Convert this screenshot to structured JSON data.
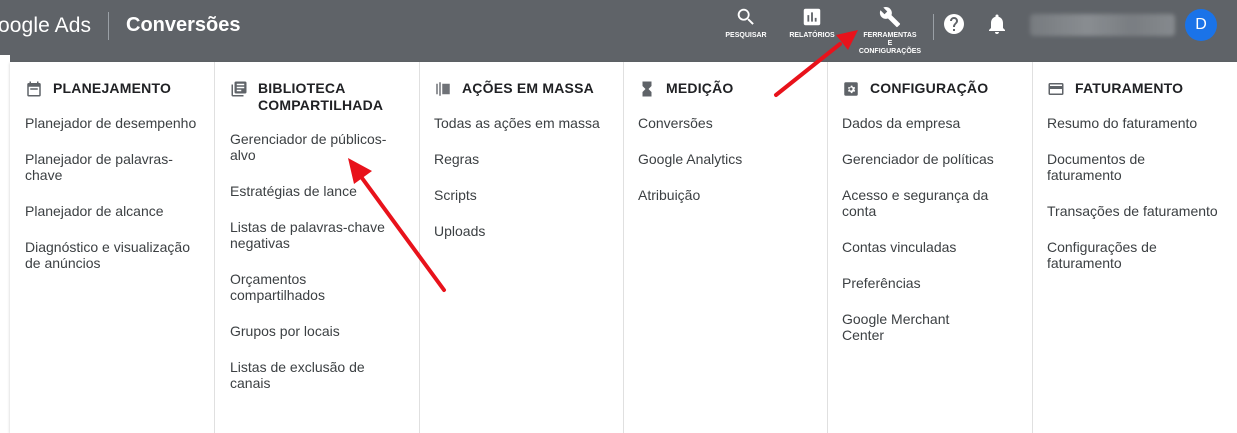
{
  "topbar": {
    "brand": "oogle Ads",
    "page_title": "Conversões",
    "tools": [
      {
        "label": "PESQUISAR",
        "icon": "search-icon"
      },
      {
        "label": "RELATÓRIOS",
        "icon": "reports-icon"
      },
      {
        "label": "FERRAMENTAS\nE\nCONFIGURAÇÕES",
        "icon": "wrench-icon"
      }
    ],
    "avatar_letter": "D"
  },
  "menu": {
    "columns": [
      {
        "header": "PLANEJAMENTO",
        "icon": "calendar-icon",
        "items": [
          "Planejador de desempenho",
          "Planejador de palavras-\nchave",
          "Planejador de alcance",
          "Diagnóstico e visualização\nde anúncios"
        ]
      },
      {
        "header": "BIBLIOTECA\nCOMPARTILHADA",
        "icon": "library-icon",
        "items": [
          "Gerenciador de públicos-\nalvo",
          "Estratégias de lance",
          "Listas de palavras-chave\nnegativas",
          "Orçamentos\ncompartilhados",
          "Grupos por locais",
          "Listas de exclusão de\ncanais"
        ]
      },
      {
        "header": "AÇÕES EM MASSA",
        "icon": "bulk-actions-icon",
        "items": [
          "Todas as ações em massa",
          "Regras",
          "Scripts",
          "Uploads"
        ]
      },
      {
        "header": "MEDIÇÃO",
        "icon": "hourglass-icon",
        "items": [
          "Conversões",
          "Google Analytics",
          "Atribuição"
        ]
      },
      {
        "header": "CONFIGURAÇÃO",
        "icon": "settings-icon",
        "items": [
          "Dados da empresa",
          "Gerenciador de políticas",
          "Acesso e segurança da\nconta",
          "Contas vinculadas",
          "Preferências",
          "Google Merchant\nCenter"
        ]
      },
      {
        "header": "FATURAMENTO",
        "icon": "credit-card-icon",
        "items": [
          "Resumo do faturamento",
          "Documentos de\nfaturamento",
          "Transações de faturamento",
          "Configurações de\nfaturamento"
        ]
      }
    ]
  },
  "colors": {
    "topbar": "#5f6368",
    "arrow": "#e8121b",
    "avatar": "#1a73e8"
  }
}
